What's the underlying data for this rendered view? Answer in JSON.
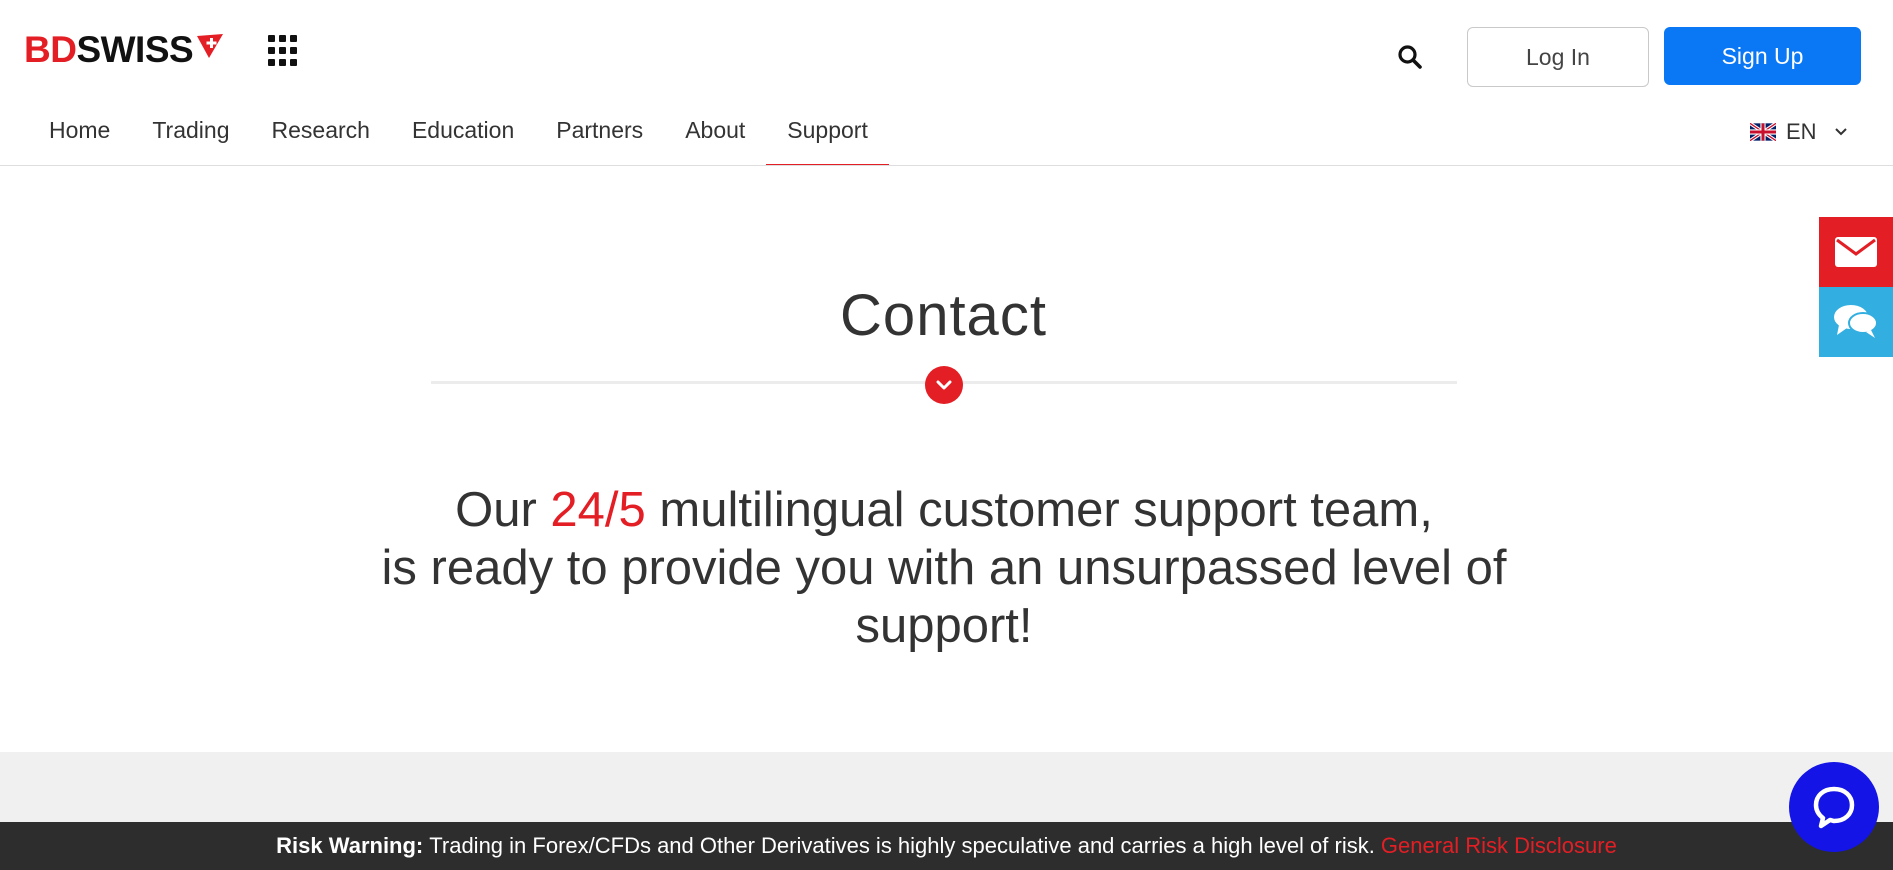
{
  "brand": {
    "logo_part1": "BD",
    "logo_part2": "SWISS",
    "primary_color": "#e31e24",
    "accent_blue": "#0a78f5",
    "chat_blue": "#33aee0"
  },
  "header": {
    "apps_icon": "grid-icon",
    "search_icon": "search-icon",
    "login_label": "Log In",
    "signup_label": "Sign Up"
  },
  "nav": {
    "items": [
      {
        "label": "Home"
      },
      {
        "label": "Trading"
      },
      {
        "label": "Research"
      },
      {
        "label": "Education"
      },
      {
        "label": "Partners"
      },
      {
        "label": "About"
      },
      {
        "label": "Support",
        "active": true
      }
    ],
    "language": {
      "code": "EN",
      "flag_icon": "uk-flag-icon"
    }
  },
  "side_tabs": {
    "mail_icon": "envelope-icon",
    "chat_icon": "chat-bubbles-icon"
  },
  "hero": {
    "title": "Contact",
    "lead_before": "Our ",
    "lead_highlight": "24/5",
    "lead_line1_after": " multilingual customer support team,",
    "lead_line2": "is ready to provide you with an unsurpassed level of support!"
  },
  "footer": {
    "risk_label": "Risk Warning:",
    "risk_text": "Trading in Forex/CFDs and Other Derivatives is highly speculative and carries a high level of risk.",
    "risk_link": "General Risk Disclosure"
  },
  "chat_widget": {
    "icon": "chat-icon"
  }
}
